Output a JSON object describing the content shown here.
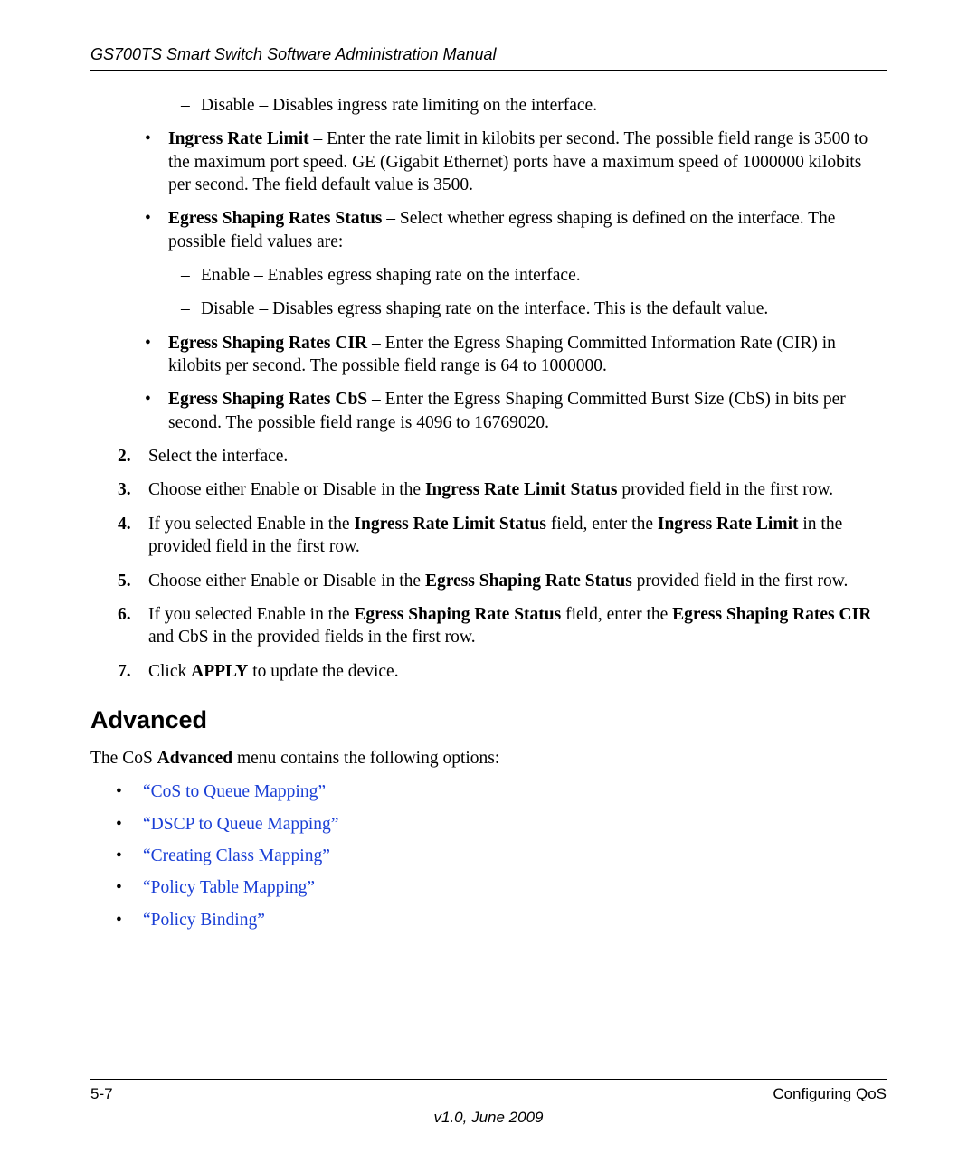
{
  "header": "GS700TS Smart Switch Software Administration Manual",
  "dash1": "Disable – Disables ingress rate limiting on the interface.",
  "b1_label": "Ingress Rate Limit",
  "b1_text": " – Enter the rate limit in kilobits per second. The possible field range is 3500 to the maximum port speed. GE (Gigabit Ethernet) ports have a maximum speed of 1000000 kilobits per second. The field default value is 3500.",
  "b2_label": "Egress Shaping Rates Status",
  "b2_text": " – Select whether egress shaping is defined on the interface. The possible field values are:",
  "b2_d1": "Enable – Enables egress shaping rate on the interface.",
  "b2_d2": "Disable – Disables egress shaping rate on the interface. This is the default value.",
  "b3_label": "Egress Shaping Rates CIR",
  "b3_text": " – Enter the Egress Shaping Committed Information Rate (CIR) in kilobits per second. The possible field range is 64 to 1000000.",
  "b4_label": "Egress Shaping Rates CbS",
  "b4_text": " – Enter the Egress Shaping Committed Burst Size (CbS) in bits per second. The possible field range is 4096 to 16769020.",
  "s2_num": "2.",
  "s2": "Select the interface.",
  "s3_num": "3.",
  "s3_a": "Choose either Enable or Disable in the ",
  "s3_b": "Ingress Rate Limit Status",
  "s3_c": " provided field in the first row.",
  "s4_num": "4.",
  "s4_a": "If you selected Enable in the ",
  "s4_b": "Ingress Rate Limit Status",
  "s4_c": " field, enter the ",
  "s4_d": "Ingress Rate Limit",
  "s4_e": " in the provided field in the first row.",
  "s5_num": "5.",
  "s5_a": "Choose either Enable or Disable in the ",
  "s5_b": "Egress Shaping Rate Status",
  "s5_c": " provided field in the first row.",
  "s6_num": "6.",
  "s6_a": "If you selected Enable in the ",
  "s6_b": "Egress Shaping Rate Status",
  "s6_c": " field, enter the ",
  "s6_d": "Egress Shaping Rates CIR",
  "s6_e": "  and CbS in the provided fields in the first row.",
  "s7_num": "7.",
  "s7_a": "Click ",
  "s7_b": "APPLY",
  "s7_c": " to update the device.",
  "adv_title": "Advanced",
  "adv_intro_a": "The CoS ",
  "adv_intro_b": "Advanced",
  "adv_intro_c": " menu contains the following options:",
  "link1": "“CoS to Queue Mapping”",
  "link2": "“DSCP to Queue Mapping”",
  "link3": "“Creating Class Mapping”",
  "link4": "“Policy Table Mapping”",
  "link5": "“Policy Binding”",
  "footer_left": "5-7",
  "footer_right": "Configuring QoS",
  "footer_version": "v1.0, June 2009"
}
